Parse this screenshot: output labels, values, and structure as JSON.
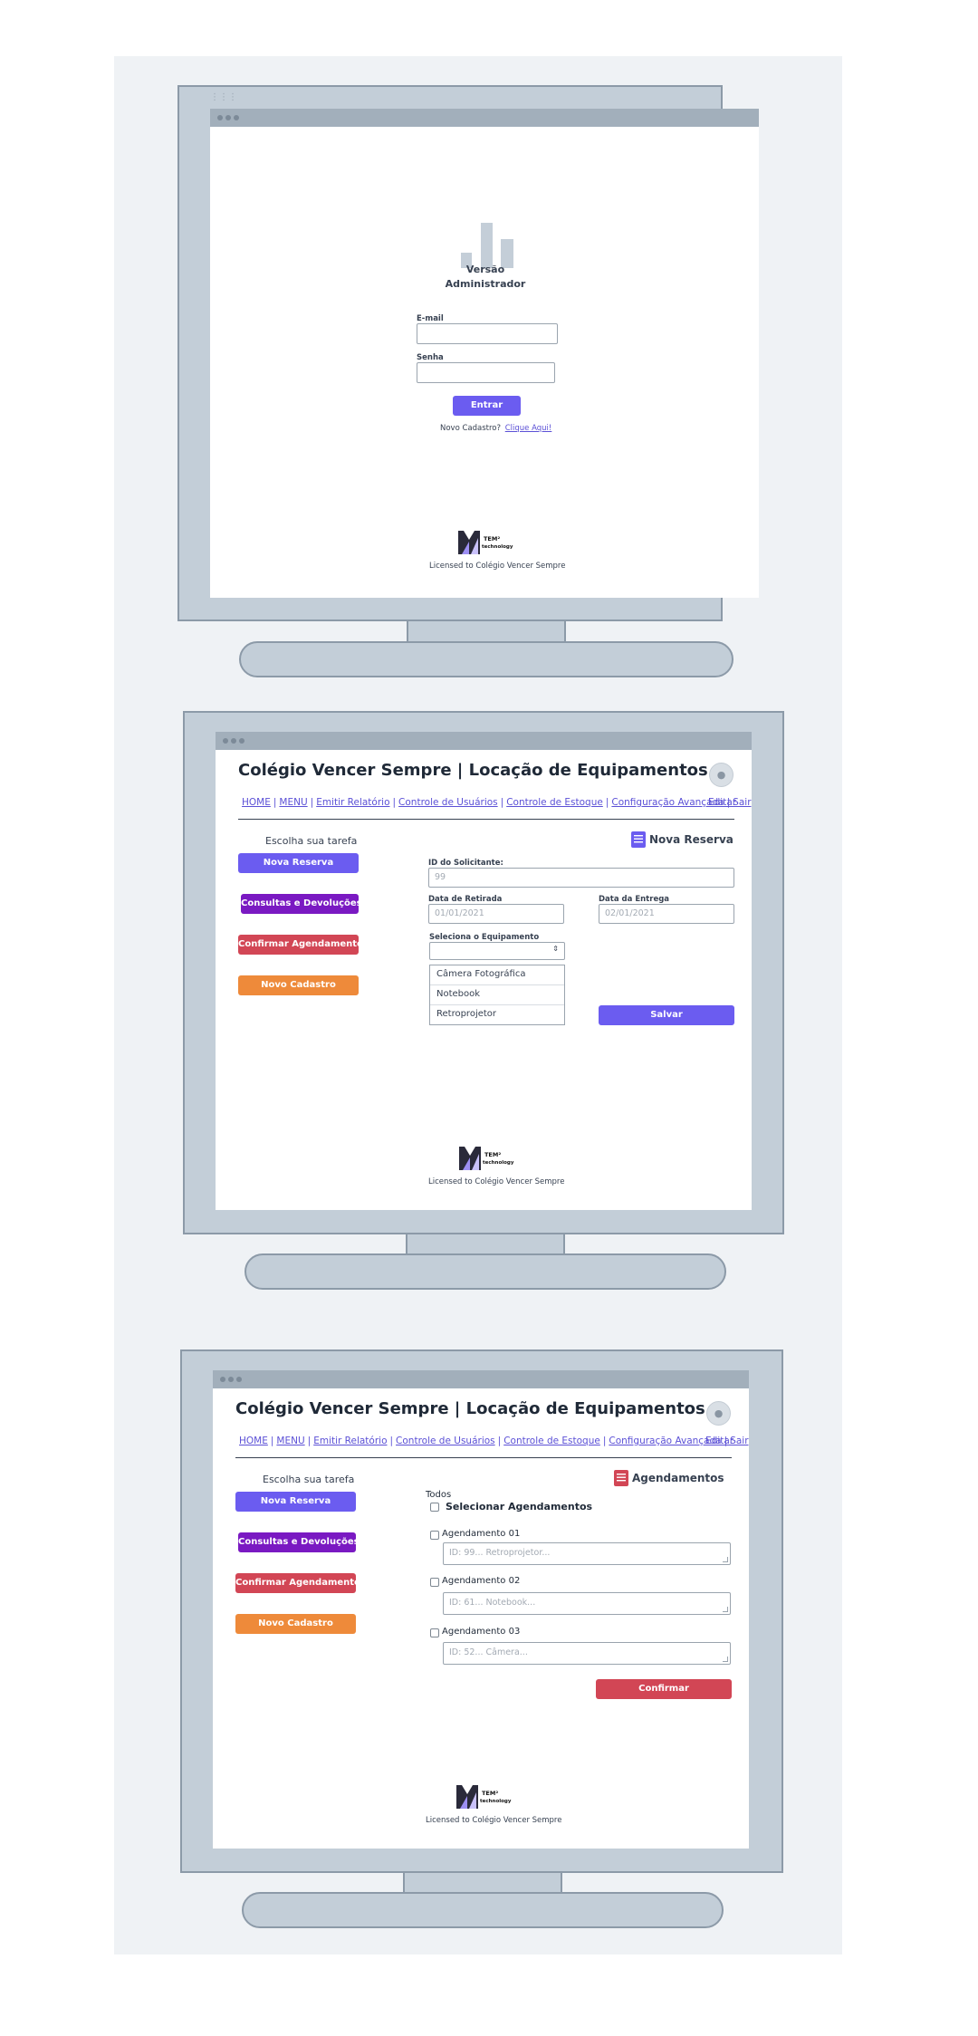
{
  "login": {
    "heading_line1": "Versão",
    "heading_line2": "Administrador",
    "email_label": "E-mail",
    "password_label": "Senha",
    "submit_label": "Entrar",
    "signup_prompt": "Novo Cadastro?",
    "signup_link": "Clique Aqui!"
  },
  "brand": {
    "logo_text_1": "TEM²",
    "logo_text_2": "technology",
    "license": "Licensed to Colégio Vencer Sempre"
  },
  "app": {
    "title": "Colégio Vencer Sempre | Locação de Equipamentos",
    "nav": [
      "HOME",
      "MENU",
      "Emitir Relatório",
      "Controle de Usuários",
      "Controle de Estoque",
      "Configuração Avançada",
      "Sair"
    ],
    "edit": "Editar",
    "task_heading": "Escolha sua tarefa",
    "tasks": [
      "Nova Reserva",
      "Consultas e Devoluções",
      "Confirmar Agendamento",
      "Novo Cadastro"
    ]
  },
  "reserva": {
    "section_title": "Nova Reserva",
    "requester_label": "ID do Solicitante:",
    "requester_placeholder": "99",
    "pickup_label": "Data de Retirada",
    "pickup_placeholder": "01/01/2021",
    "delivery_label": "Data da Entrega",
    "delivery_placeholder": "02/01/2021",
    "equipment_label": "Seleciona o Equipamento",
    "equipment_options": [
      "Câmera Fotográfica",
      "Notebook",
      "Retroprojetor"
    ],
    "save_label": "Salvar"
  },
  "agendamentos": {
    "section_title": "Agendamentos",
    "all_label": "Todos",
    "select_all_label": "Selecionar Agendamentos",
    "items": [
      {
        "label": "Agendamento 01",
        "placeholder": "ID: 99... Retroprojetor..."
      },
      {
        "label": "Agendamento 02",
        "placeholder": "ID: 61... Notebook..."
      },
      {
        "label": "Agendamento 03",
        "placeholder": "ID: 52... Câmera..."
      }
    ],
    "confirm_label": "Confirmar"
  },
  "colors": {
    "primary": "#6b5cf0",
    "violet": "#7a19c2",
    "red": "#d24655",
    "orange": "#ee8a3a",
    "monitor": "#c3ced8",
    "board": "#eff2f5"
  }
}
